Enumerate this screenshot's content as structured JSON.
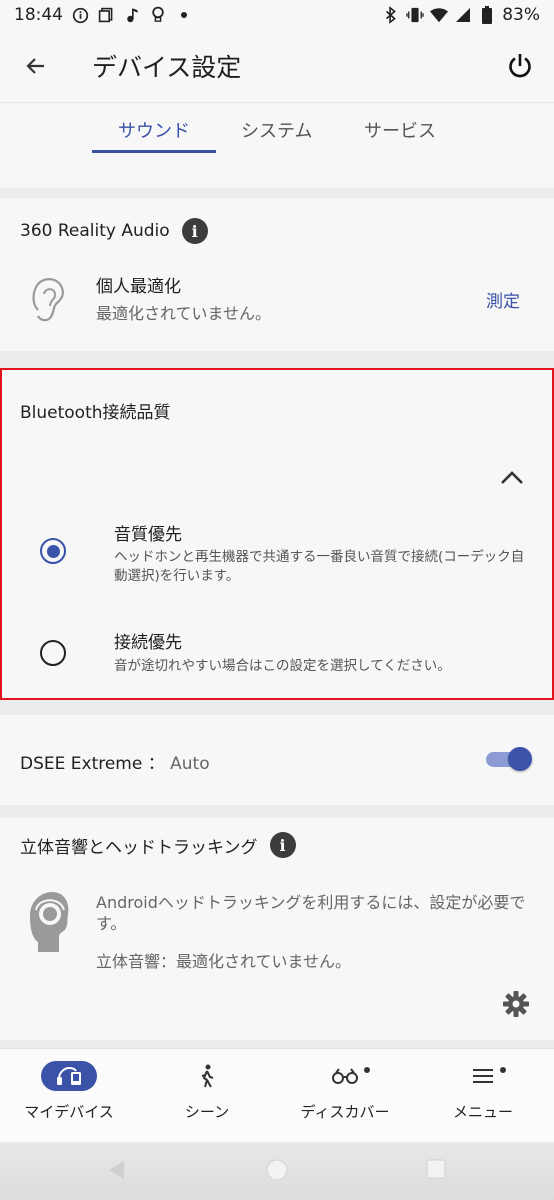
{
  "status_bar": {
    "time": "18:44",
    "battery": "83%"
  },
  "app_bar": {
    "title": "デバイス設定"
  },
  "tabs": [
    {
      "label": "サウンド",
      "active": true
    },
    {
      "label": "システム",
      "active": false
    },
    {
      "label": "サービス",
      "active": false
    }
  ],
  "reality_audio": {
    "title": "360 Reality Audio",
    "personalize_title": "個人最適化",
    "personalize_status": "最適化されていません。",
    "measure_label": "測定"
  },
  "bluetooth": {
    "title": "Bluetooth接続品質",
    "options": [
      {
        "title": "音質優先",
        "description": "ヘッドホンと再生機器で共通する一番良い音質で接続(コーデック自動選択)を行います。",
        "selected": true
      },
      {
        "title": "接続優先",
        "description": "音が途切れやすい場合はこの設定を選択してください。",
        "selected": false
      }
    ]
  },
  "dsee": {
    "label": "DSEE Extreme",
    "separator": "：",
    "value": "Auto",
    "enabled": true
  },
  "spatial": {
    "title": "立体音響とヘッドトラッキング",
    "description": "Androidヘッドトラッキングを利用するには、設定が必要です。",
    "status": "立体音響：最適化されていません。"
  },
  "bottom_nav": [
    {
      "label": "マイデバイス",
      "icon": "headphones-device-icon",
      "active": true
    },
    {
      "label": "シーン",
      "icon": "walking-person-icon",
      "active": false
    },
    {
      "label": "ディスカバー",
      "icon": "binoculars-icon",
      "active": false
    },
    {
      "label": "メニュー",
      "icon": "menu-icon",
      "active": false
    }
  ],
  "colors": {
    "accent": "#3a52a8",
    "highlight_border": "#e0141a",
    "toggle_track": "#8c9bd6"
  }
}
